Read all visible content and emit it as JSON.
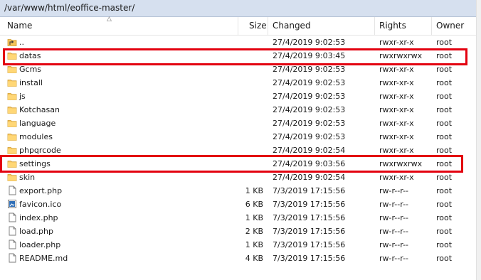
{
  "path": "/var/www/html/eoffice-master/",
  "columns": {
    "name": "Name",
    "size": "Size",
    "changed": "Changed",
    "rights": "Rights",
    "owner": "Owner"
  },
  "colors": {
    "highlight": "#e3000f",
    "folder": "#f4c35a",
    "pathbar": "#d6e0ef"
  },
  "files": [
    {
      "name": "..",
      "size": "",
      "changed": "27/4/2019 9:02:53",
      "rights": "rwxr-xr-x",
      "owner": "root",
      "icon": "parent-folder-icon"
    },
    {
      "name": "datas",
      "size": "",
      "changed": "27/4/2019 9:03:45",
      "rights": "rwxrwxrwx",
      "owner": "root",
      "icon": "folder-icon"
    },
    {
      "name": "Gcms",
      "size": "",
      "changed": "27/4/2019 9:02:53",
      "rights": "rwxr-xr-x",
      "owner": "root",
      "icon": "folder-icon"
    },
    {
      "name": "install",
      "size": "",
      "changed": "27/4/2019 9:02:53",
      "rights": "rwxr-xr-x",
      "owner": "root",
      "icon": "folder-icon"
    },
    {
      "name": "js",
      "size": "",
      "changed": "27/4/2019 9:02:53",
      "rights": "rwxr-xr-x",
      "owner": "root",
      "icon": "folder-icon"
    },
    {
      "name": "Kotchasan",
      "size": "",
      "changed": "27/4/2019 9:02:53",
      "rights": "rwxr-xr-x",
      "owner": "root",
      "icon": "folder-icon"
    },
    {
      "name": "language",
      "size": "",
      "changed": "27/4/2019 9:02:53",
      "rights": "rwxr-xr-x",
      "owner": "root",
      "icon": "folder-icon"
    },
    {
      "name": "modules",
      "size": "",
      "changed": "27/4/2019 9:02:53",
      "rights": "rwxr-xr-x",
      "owner": "root",
      "icon": "folder-icon"
    },
    {
      "name": "phpqrcode",
      "size": "",
      "changed": "27/4/2019 9:02:54",
      "rights": "rwxr-xr-x",
      "owner": "root",
      "icon": "folder-icon"
    },
    {
      "name": "settings",
      "size": "",
      "changed": "27/4/2019 9:03:56",
      "rights": "rwxrwxrwx",
      "owner": "root",
      "icon": "folder-icon"
    },
    {
      "name": "skin",
      "size": "",
      "changed": "27/4/2019 9:02:54",
      "rights": "rwxr-xr-x",
      "owner": "root",
      "icon": "folder-icon"
    },
    {
      "name": "export.php",
      "size": "1 KB",
      "changed": "7/3/2019 17:15:56",
      "rights": "rw-r--r--",
      "owner": "root",
      "icon": "file-icon"
    },
    {
      "name": "favicon.ico",
      "size": "6 KB",
      "changed": "7/3/2019 17:15:56",
      "rights": "rw-r--r--",
      "owner": "root",
      "icon": "image-file-icon"
    },
    {
      "name": "index.php",
      "size": "1 KB",
      "changed": "7/3/2019 17:15:56",
      "rights": "rw-r--r--",
      "owner": "root",
      "icon": "file-icon"
    },
    {
      "name": "load.php",
      "size": "2 KB",
      "changed": "7/3/2019 17:15:56",
      "rights": "rw-r--r--",
      "owner": "root",
      "icon": "file-icon"
    },
    {
      "name": "loader.php",
      "size": "1 KB",
      "changed": "7/3/2019 17:15:56",
      "rights": "rw-r--r--",
      "owner": "root",
      "icon": "file-icon"
    },
    {
      "name": "README.md",
      "size": "4 KB",
      "changed": "7/3/2019 17:15:56",
      "rights": "rw-r--r--",
      "owner": "root",
      "icon": "file-icon"
    }
  ]
}
